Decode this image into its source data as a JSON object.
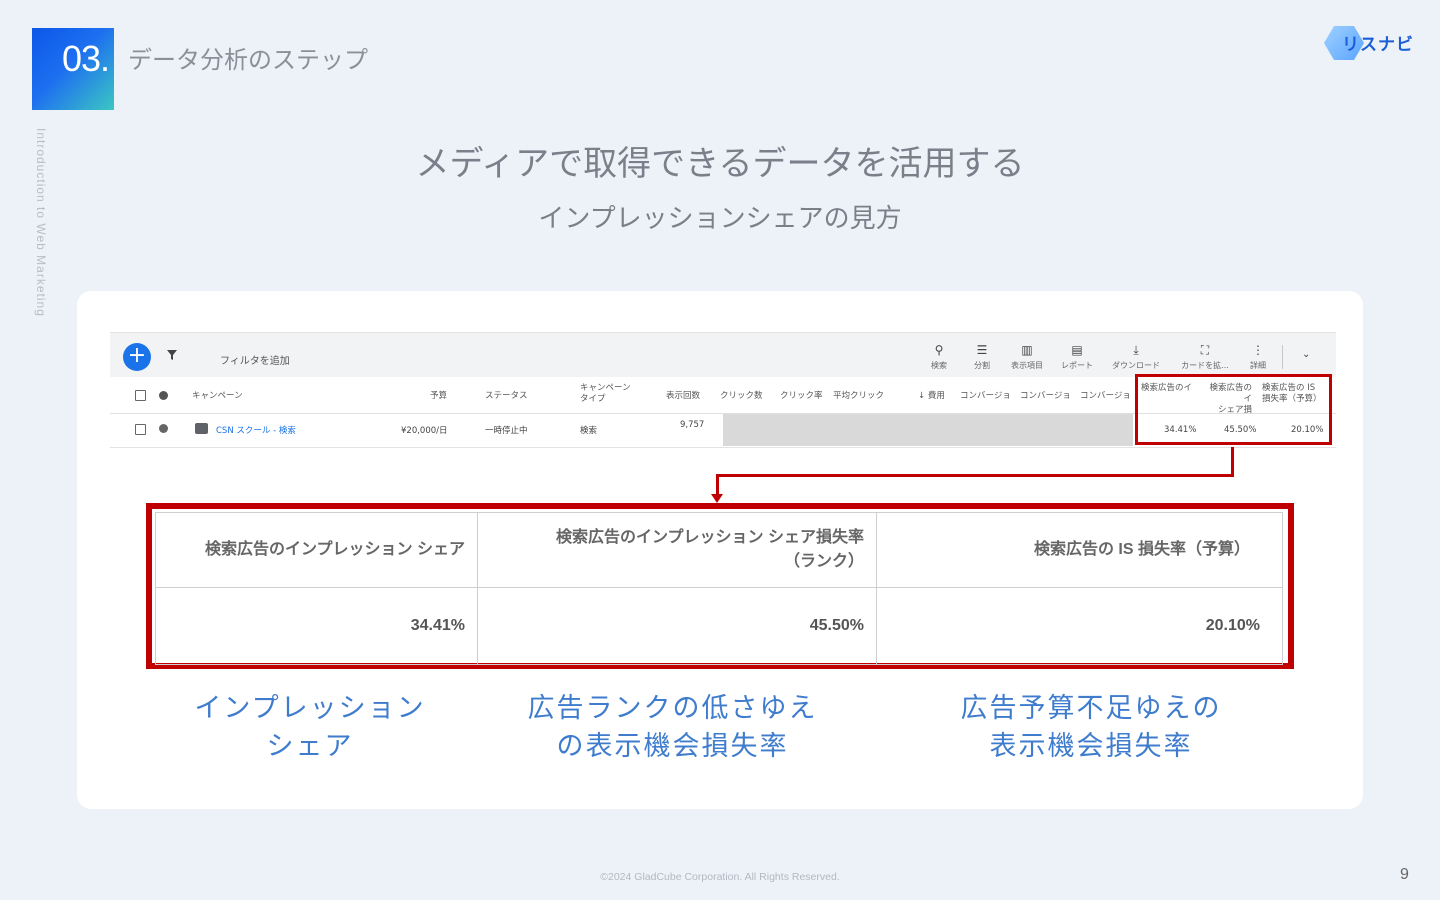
{
  "header": {
    "section_number": "03.",
    "section_title": "データ分析のステップ",
    "vertical_label": "Introduction to Web Marketing",
    "logo_text": "リスナビ"
  },
  "slide": {
    "title": "メディアで取得できるデータを活用する",
    "subtitle": "インプレッションシェアの見方"
  },
  "ads_screenshot": {
    "filter_placeholder": "フィルタを追加",
    "toolbar": [
      {
        "icon": "search-icon",
        "label": "検索"
      },
      {
        "icon": "segment-icon",
        "label": "分割"
      },
      {
        "icon": "columns-icon",
        "label": "表示項目"
      },
      {
        "icon": "report-icon",
        "label": "レポート"
      },
      {
        "icon": "download-icon",
        "label": "ダウンロード"
      },
      {
        "icon": "fullscreen-icon",
        "label": "カードを拡..."
      },
      {
        "icon": "more-icon",
        "label": "詳細"
      }
    ],
    "columns": {
      "campaign": "キャンペーン",
      "budget": "予算",
      "status": "ステータス",
      "campaign_type_1": "キャンペーン",
      "campaign_type_2": "タイプ",
      "impressions": "表示回数",
      "clicks": "クリック数",
      "ctr": "クリック率",
      "avg_cpc": "平均クリック",
      "cost": "↓ 費用",
      "conv1": "コンバージョ",
      "conv2": "コンバージョ",
      "conv3": "コンバージョ",
      "is_1": "検索広告のイ",
      "is_lost_rank_1": "検索広告のイ",
      "is_lost_rank_2": "シェア損",
      "is_lost_budget_1": "検索広告の IS",
      "is_lost_budget_2": "損失率（予算）"
    },
    "row": {
      "campaign": "CSN スクール - 検索",
      "budget": "¥20,000/日",
      "status": "一時停止中",
      "type": "検索",
      "impressions": "9,757",
      "is": "34.41%",
      "is_lost_rank": "45.50%",
      "is_lost_budget": "20.10%"
    }
  },
  "zoom_table": {
    "headers": [
      "検索広告のインプレッション シェア",
      "検索広告のインプレッション シェア損失率",
      "検索広告の IS 損失率（予算）"
    ],
    "header_2_line2": "（ランク）",
    "values": [
      "34.41%",
      "45.50%",
      "20.10%"
    ]
  },
  "captions": [
    {
      "line1": "インプレッション",
      "line2": "シェア"
    },
    {
      "line1": "広告ランクの低さゆえ",
      "line2": "の表示機会損失率"
    },
    {
      "line1": "広告予算不足ゆえの",
      "line2": "表示機会損失率"
    }
  ],
  "footer": {
    "copyright": "©2024 GladCube Corporation. All Rights Reserved.",
    "page_number": "9"
  },
  "colors": {
    "accent_blue": "#1a73e8",
    "highlight_red": "#c00000",
    "caption_blue": "#3f7ccd"
  }
}
